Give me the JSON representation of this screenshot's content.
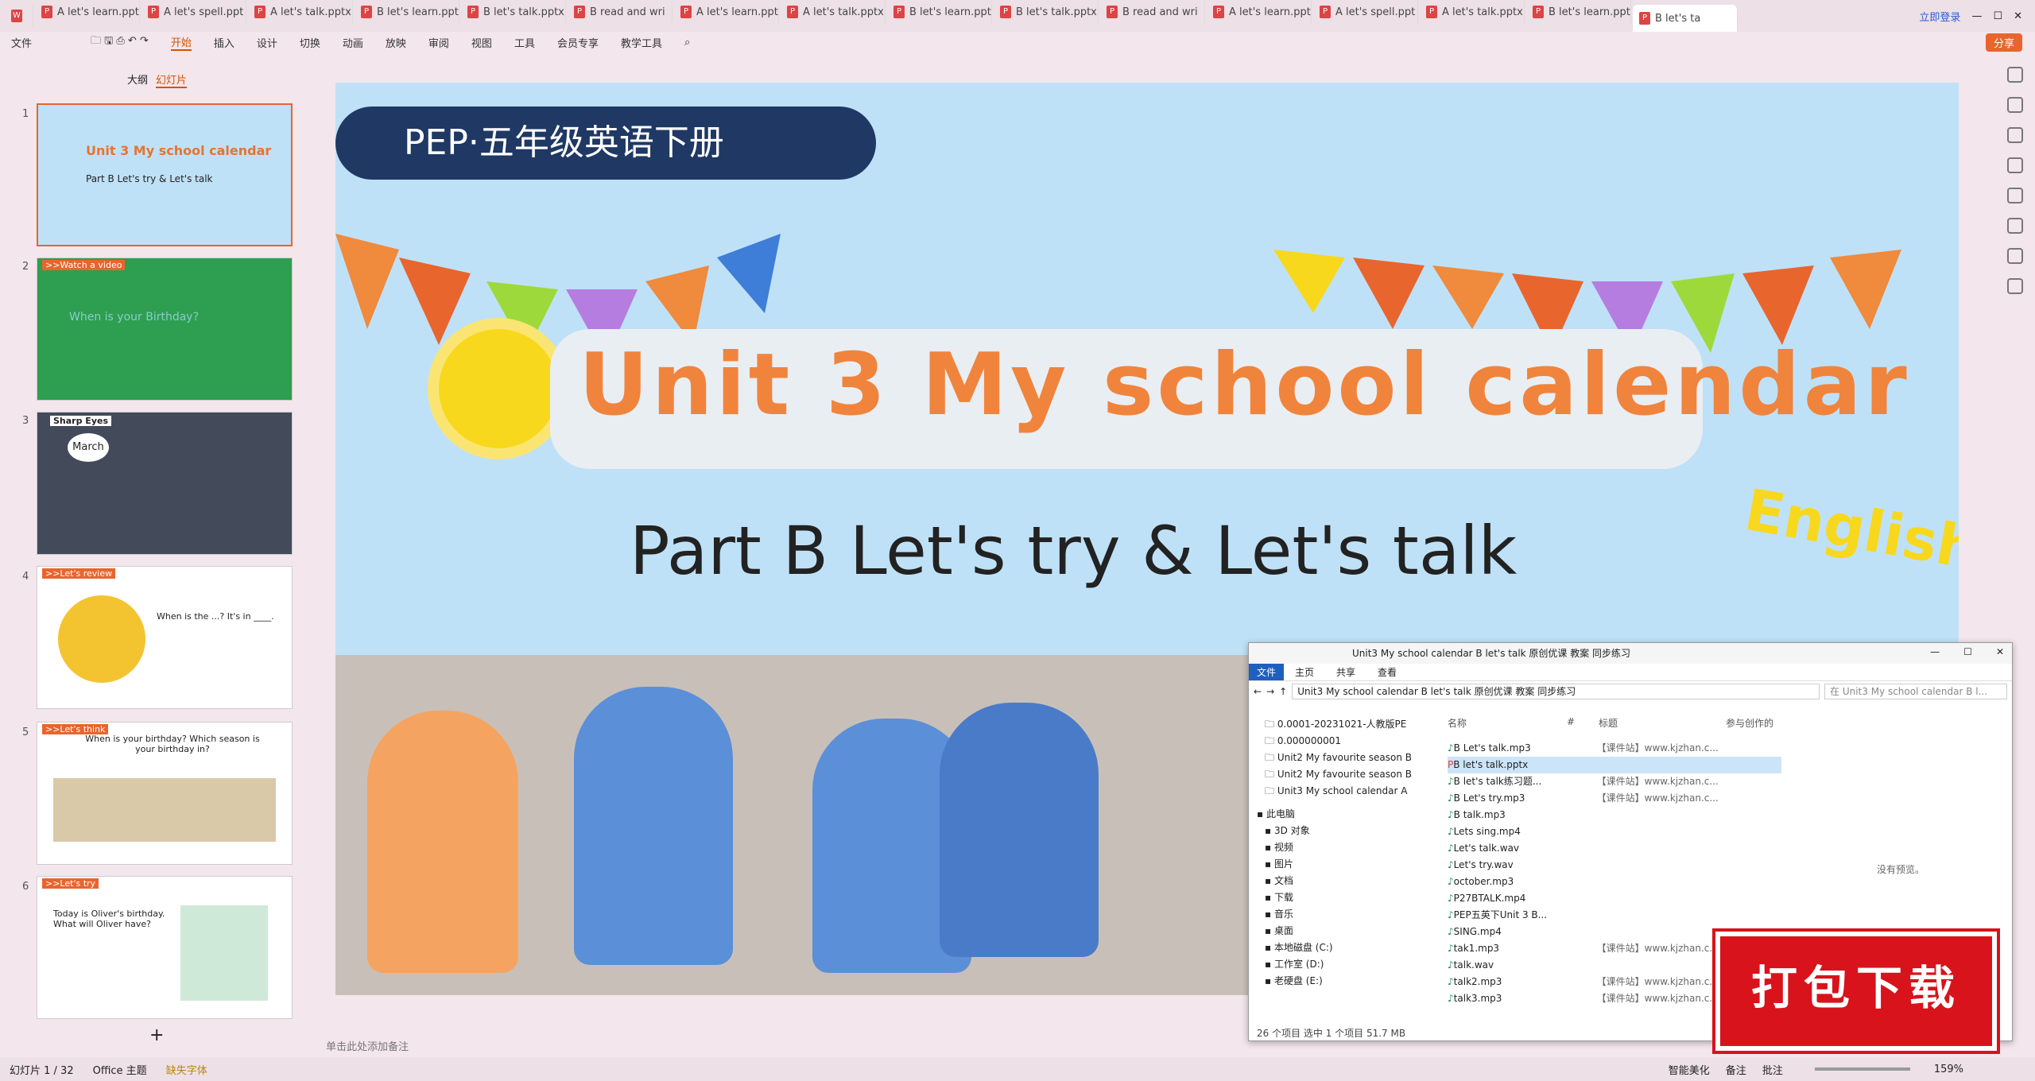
{
  "tabs": [
    "A let's learn.ppt",
    "A let's spell.ppt",
    "A let's talk.pptx",
    "B let's learn.ppt",
    "B let's talk.pptx",
    "B read and wri",
    "A let's learn.ppt",
    "A let's talk.pptx",
    "B let's learn.ppt",
    "B let's talk.pptx",
    "B read and wri",
    "A let's learn.ppt",
    "A let's spell.ppt",
    "A let's talk.pptx",
    "B let's learn.ppt",
    "B let's ta"
  ],
  "login": "立即登录",
  "share": "分享",
  "menu": [
    "文件",
    "开始",
    "插入",
    "设计",
    "切换",
    "动画",
    "放映",
    "审阅",
    "视图",
    "工具",
    "会员专享",
    "教学工具"
  ],
  "sidebar": {
    "outline": "大纲",
    "slides": "幻灯片",
    "add": "+"
  },
  "thumbs": [
    {
      "n": "1",
      "title": "Unit 3 My school calendar",
      "sub": "Part B Let's try & Let's talk"
    },
    {
      "n": "2",
      "title": ">>Watch a video",
      "sub": "When is your Birthday?"
    },
    {
      "n": "3",
      "title": "Sharp Eyes",
      "sub": "March"
    },
    {
      "n": "4",
      "title": ">>Let's review",
      "sub": "When is the ...? It's in ____."
    },
    {
      "n": "5",
      "title": ">>Let's think",
      "sub": "When is your birthday? Which season is your birthday in?"
    },
    {
      "n": "6",
      "title": ">>Let's try",
      "sub": "Today is Oliver's birthday. What will Oliver have?"
    }
  ],
  "slide": {
    "banner": "PEP·五年级英语下册",
    "title": "Unit 3 My school calendar",
    "subtitle": "Part B  Let's try & Let's talk",
    "badge": "English"
  },
  "notes": "单击此处添加备注",
  "explorer": {
    "title": "Unit3 My school calendar B let's talk 原创优课 教案 同步练习",
    "ribbon": [
      "文件",
      "主页",
      "共享",
      "查看"
    ],
    "path": "Unit3 My school calendar B let's talk 原创优课 教案 同步练习",
    "search": "在 Unit3 My school calendar B l...",
    "tree": [
      "0.0001-20231021-人教版PE",
      "0.000000001",
      "Unit2 My favourite season B",
      "Unit2 My favourite season B",
      "Unit3 My school calendar A",
      "此电脑",
      "3D 对象",
      "视频",
      "图片",
      "文档",
      "下载",
      "音乐",
      "桌面",
      "本地磁盘 (C:)",
      "工作室 (D:)",
      "老硬盘 (E:)"
    ],
    "cols": [
      "名称",
      "#",
      "标题",
      "参与创作的"
    ],
    "files": [
      {
        "name": "B Let's talk.mp3",
        "title": "【课件站】www.kjzhan.c..."
      },
      {
        "name": "B let's talk.pptx",
        "title": ""
      },
      {
        "name": "B let's talk练习题...",
        "title": "【课件站】www.kjzhan.c..."
      },
      {
        "name": "B Let's try.mp3",
        "title": "【课件站】www.kjzhan.c..."
      },
      {
        "name": "B talk.mp3",
        "title": ""
      },
      {
        "name": "Lets sing.mp4",
        "title": ""
      },
      {
        "name": "Let's talk.wav",
        "title": ""
      },
      {
        "name": "Let's try.wav",
        "title": ""
      },
      {
        "name": "october.mp3",
        "title": ""
      },
      {
        "name": "P27BTALK.mp4",
        "title": ""
      },
      {
        "name": "PEP五英下Unit 3 B...",
        "title": ""
      },
      {
        "name": "SING.mp4",
        "title": ""
      },
      {
        "name": "tak1.mp3",
        "title": "【课件站】www.kjzhan.c..."
      },
      {
        "name": "talk.wav",
        "title": ""
      },
      {
        "name": "talk2.mp3",
        "title": "【课件站】www.kjzhan.c..."
      },
      {
        "name": "talk3.mp3",
        "title": "【课件站】www.kjzhan.c..."
      }
    ],
    "preview": "没有预览。",
    "status": "26 个项目    选中 1 个项目  51.7 MB"
  },
  "download": "打包下载",
  "statusbar": {
    "page": "幻灯片 1 / 32",
    "theme": "Office 主题",
    "font": "缺失字体",
    "beautify": "智能美化",
    "notes": "备注",
    "comment": "批注",
    "zoom": "159%"
  }
}
